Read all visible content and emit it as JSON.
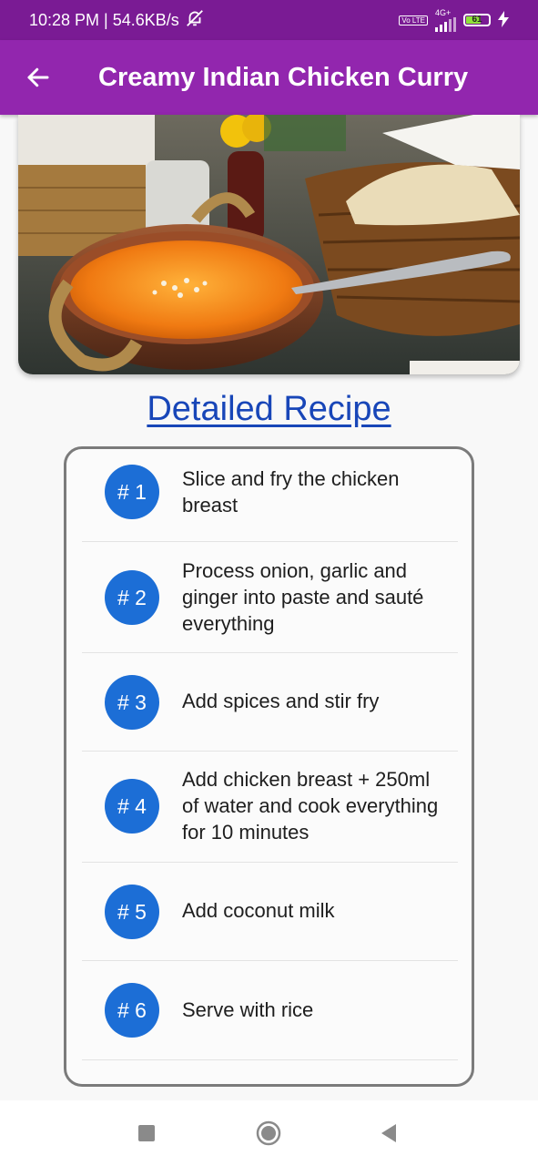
{
  "status_bar": {
    "time_speed": "10:28 PM | 54.6KB/s",
    "network": "4G+",
    "volte": "Vo LTE",
    "battery_level": "61"
  },
  "app_bar": {
    "title": "Creamy Indian Chicken Curry",
    "color": "#9226ae"
  },
  "recipe": {
    "heading": "Detailed Recipe",
    "steps": [
      {
        "number": "# 1",
        "text": "Slice and fry the chicken breast"
      },
      {
        "number": "# 2",
        "text": "Process onion, garlic and ginger into paste and sauté everything"
      },
      {
        "number": "# 3",
        "text": "Add spices and stir fry"
      },
      {
        "number": "# 4",
        "text": "Add chicken breast + 250ml of water and cook everything for 10 minutes"
      },
      {
        "number": "# 5",
        "text": "Add coconut milk"
      },
      {
        "number": "# 6",
        "text": "Serve with rice"
      }
    ]
  },
  "colors": {
    "accent": "#1c6ed6",
    "heading": "#1846b8",
    "status_bar": "#7a1b94"
  },
  "icons": {
    "back": "arrow-left-icon",
    "nav_recent": "square-icon",
    "nav_home": "circle-icon",
    "nav_back": "triangle-back-icon"
  }
}
